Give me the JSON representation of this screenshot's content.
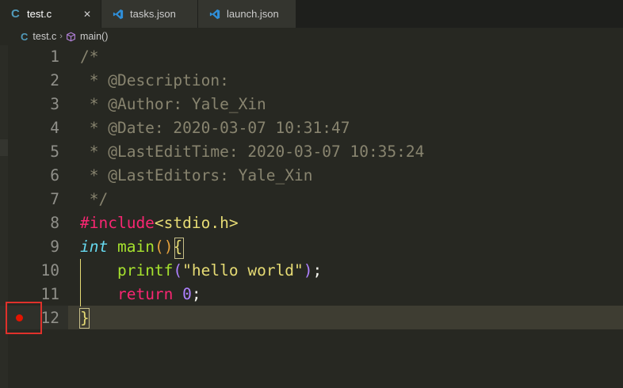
{
  "tabs": [
    {
      "label": "test.c",
      "icon": "c-file-icon",
      "active": true,
      "close": "✕"
    },
    {
      "label": "tasks.json",
      "icon": "vscode-icon",
      "active": false
    },
    {
      "label": "launch.json",
      "icon": "vscode-icon",
      "active": false
    }
  ],
  "breadcrumb": {
    "file": "test.c",
    "separator": "›",
    "symbol": "main()"
  },
  "icons": {
    "c_glyph": "C"
  },
  "colors": {
    "background": "#272822",
    "breakpoint": "#e51400",
    "highlight_frame": "#e0312b"
  },
  "lines": [
    {
      "number": "1",
      "tokens": [
        {
          "text": "/*",
          "cls": "tk-comment"
        }
      ]
    },
    {
      "number": "2",
      "tokens": [
        {
          "text": " * @Description:",
          "cls": "tk-comment"
        }
      ]
    },
    {
      "number": "3",
      "tokens": [
        {
          "text": " * @Author: Yale_Xin",
          "cls": "tk-comment"
        }
      ]
    },
    {
      "number": "4",
      "tokens": [
        {
          "text": " * @Date: 2020-03-07 10:31:47",
          "cls": "tk-comment"
        }
      ]
    },
    {
      "number": "5",
      "tokens": [
        {
          "text": " * @LastEditTime: 2020-03-07 10:35:24",
          "cls": "tk-comment"
        }
      ]
    },
    {
      "number": "6",
      "tokens": [
        {
          "text": " * @LastEditors: Yale_Xin",
          "cls": "tk-comment"
        }
      ]
    },
    {
      "number": "7",
      "tokens": [
        {
          "text": " */",
          "cls": "tk-comment"
        }
      ]
    },
    {
      "number": "8",
      "tokens": [
        {
          "text": "#include",
          "cls": "tk-pink"
        },
        {
          "text": "<stdio.h>",
          "cls": "tk-yellow"
        }
      ]
    },
    {
      "number": "9",
      "tokens": [
        {
          "text": "int",
          "cls": "tk-int"
        },
        {
          "text": " ",
          "cls": "tk-white"
        },
        {
          "text": "main",
          "cls": "tk-green"
        },
        {
          "text": "()",
          "cls": "tk-paren"
        },
        {
          "text": "{",
          "cls": "tk-yellow"
        }
      ]
    },
    {
      "number": "10",
      "tokens": [
        {
          "text": "    ",
          "cls": "tk-white"
        },
        {
          "text": "printf",
          "cls": "tk-green"
        },
        {
          "text": "(",
          "cls": "tk-purple"
        },
        {
          "text": "\"hello world\"",
          "cls": "tk-yellow"
        },
        {
          "text": ")",
          "cls": "tk-purple"
        },
        {
          "text": ";",
          "cls": "tk-white"
        }
      ]
    },
    {
      "number": "11",
      "tokens": [
        {
          "text": "    ",
          "cls": "tk-white"
        },
        {
          "text": "return",
          "cls": "tk-pink"
        },
        {
          "text": " ",
          "cls": "tk-white"
        },
        {
          "text": "0",
          "cls": "tk-purple"
        },
        {
          "text": ";",
          "cls": "tk-white"
        }
      ]
    },
    {
      "number": "12",
      "tokens": [
        {
          "text": "}",
          "cls": "tk-yellow"
        }
      ],
      "breakpoint": true
    }
  ]
}
